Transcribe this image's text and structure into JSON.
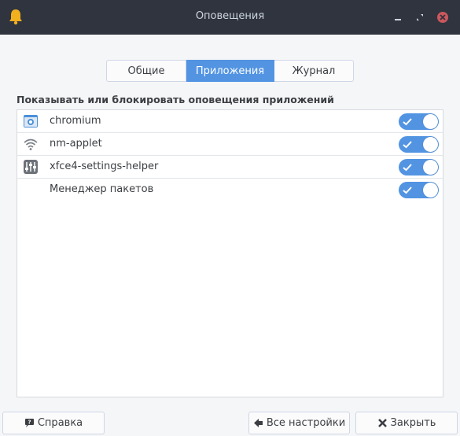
{
  "window": {
    "title": "Оповещения",
    "icon": "bell-icon"
  },
  "tabs": [
    {
      "label": "Общие",
      "active": false
    },
    {
      "label": "Приложения",
      "active": true
    },
    {
      "label": "Журнал",
      "active": false
    }
  ],
  "section": {
    "label": "Показывать или блокировать оповещения приложений"
  },
  "apps": [
    {
      "name": "chromium",
      "icon": "chromium-icon",
      "enabled": true
    },
    {
      "name": "nm-applet",
      "icon": "wifi-icon",
      "enabled": true
    },
    {
      "name": "xfce4-settings-helper",
      "icon": "settings-mixer-icon",
      "enabled": true
    },
    {
      "name": "Менеджер пакетов",
      "icon": "",
      "enabled": true
    }
  ],
  "buttons": {
    "help": "Справка",
    "all_settings": "Все настройки",
    "close": "Закрыть"
  },
  "colors": {
    "titlebar": "#2f343f",
    "accent": "#5294e2",
    "bell": "#f2b01e"
  }
}
